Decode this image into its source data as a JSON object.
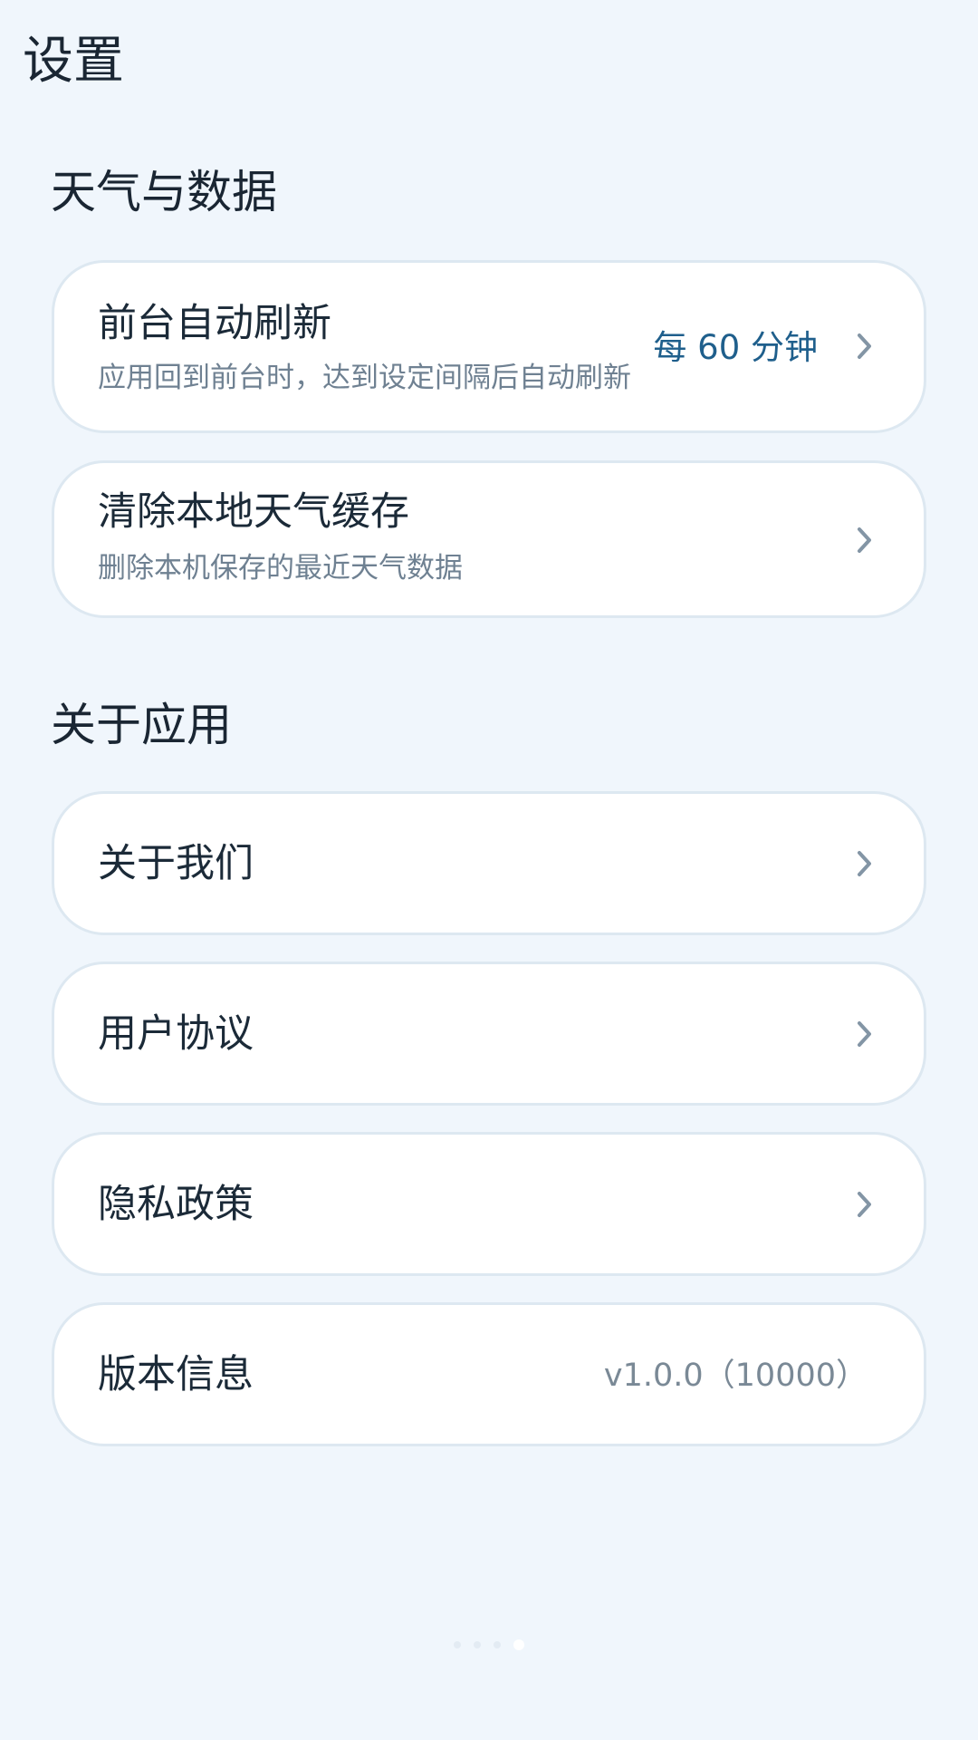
{
  "header": {
    "title": "设置"
  },
  "sections": [
    {
      "title": "天气与数据",
      "items": [
        {
          "label": "前台自动刷新",
          "description": "应用回到前台时，达到设定间隔后自动刷新",
          "value": "每 60 分钟",
          "icon": "chevron-right-icon"
        },
        {
          "label": "清除本地天气缓存",
          "description": "删除本机保存的最近天气数据",
          "icon": "chevron-right-icon"
        }
      ]
    },
    {
      "title": "关于应用",
      "items": [
        {
          "label": "关于我们",
          "icon": "chevron-right-icon"
        },
        {
          "label": "用户协议",
          "icon": "chevron-right-icon"
        },
        {
          "label": "隐私政策",
          "icon": "chevron-right-icon"
        },
        {
          "label": "版本信息",
          "value": "v1.0.0（10000）"
        }
      ]
    }
  ],
  "pager": {
    "count": 4,
    "active_index": 3
  },
  "colors": {
    "background": "#f0f6fc",
    "card": "#ffffff",
    "card_border": "#dde8f1",
    "accent": "#1f5f8c",
    "muted": "#7a8996",
    "text": "#1b2a38"
  }
}
